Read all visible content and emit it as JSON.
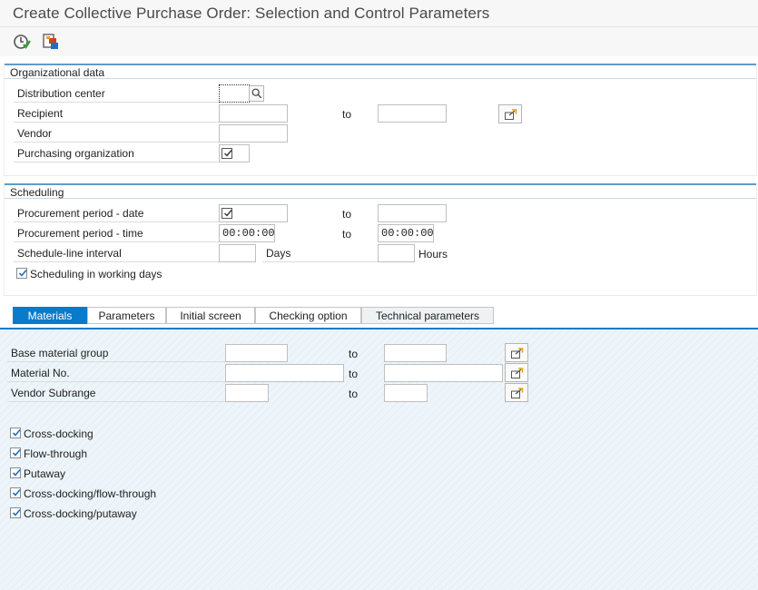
{
  "window": {
    "title": "Create Collective Purchase Order: Selection and Control Parameters"
  },
  "toolbar": {
    "execute_icon": "execute-clock-icon",
    "variant_icon": "get-variant-icon"
  },
  "org": {
    "title": "Organizational data",
    "distribution_center": "Distribution center",
    "recipient": "Recipient",
    "recipient_to": "to",
    "vendor": "Vendor",
    "purchasing_org": "Purchasing organization",
    "purchasing_org_checked": true
  },
  "sched": {
    "title": "Scheduling",
    "proc_date": "Procurement period - date",
    "proc_date_to": "to",
    "proc_time": "Procurement period - time",
    "proc_time_from": "00:00:00",
    "proc_time_to_label": "to",
    "proc_time_to": "00:00:00",
    "sl_interval": "Schedule-line interval",
    "days": "Days",
    "hours": "Hours",
    "working_days": "Scheduling in working days",
    "working_days_checked": true
  },
  "tabs": [
    "Materials",
    "Parameters",
    "Initial screen",
    "Checking option",
    "Technical parameters"
  ],
  "materials": {
    "base_group": "Base material group",
    "base_group_to": "to",
    "material_no": "Material No.",
    "material_no_to": "to",
    "vendor_subrange": "Vendor Subrange",
    "vendor_subrange_to": "to",
    "checks": [
      {
        "label": "Cross-docking",
        "checked": true
      },
      {
        "label": "Flow-through",
        "checked": true
      },
      {
        "label": "Putaway",
        "checked": true
      },
      {
        "label": "Cross-docking/flow-through",
        "checked": true
      },
      {
        "label": "Cross-docking/putaway",
        "checked": true
      }
    ]
  },
  "colors": {
    "accent": "#0a7acb",
    "group_border": "#5f9bc9"
  }
}
